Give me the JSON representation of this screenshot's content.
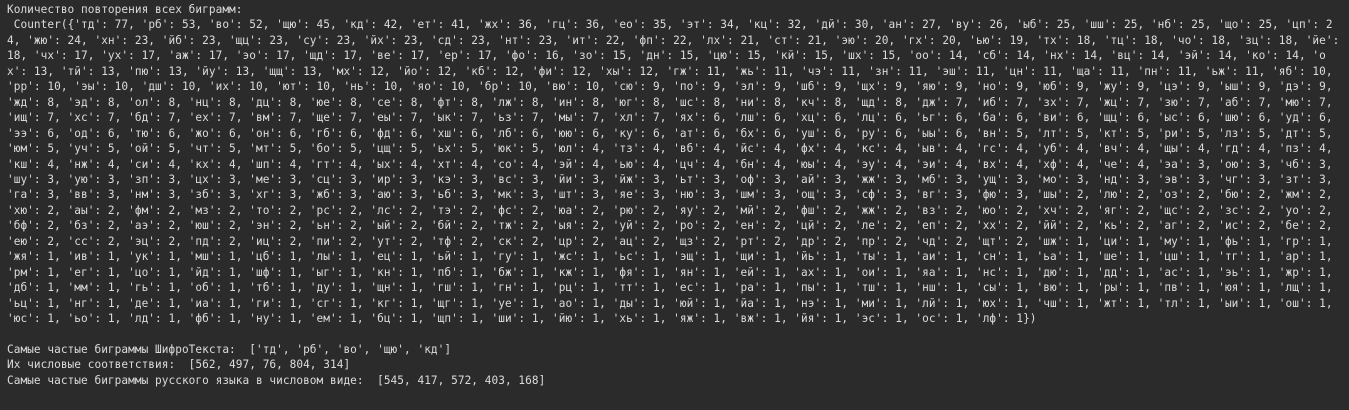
{
  "console": {
    "heading": "Количество повторения всех биграмм:",
    "counter_output": " Counter({'тд': 77, 'рб': 53, 'во': 52, 'щю': 45, 'кд': 42, 'ет': 41, 'жх': 36, 'гц': 36, 'ео': 35, 'эт': 34, 'кц': 32, 'дй': 30, 'ан': 27, 'ву': 26, 'ыб': 25, 'шш': 25, 'нб': 25, 'що': 25, 'цп': 24, 'жю': 24, 'хн': 23, 'йб': 23, 'щц': 23, 'су': 23, 'йх': 23, 'сд': 23, 'нт': 23, 'ит': 22, 'фп': 22, 'лх': 21, 'ст': 21, 'эю': 20, 'гх': 20, 'ью': 19, 'тх': 18, 'тц': 18, 'чо': 18, 'зц': 18, 'йе': 18, 'чх': 17, 'ух': 17, 'аж': 17, 'эо': 17, 'щд': 17, 'ве': 17, 'ер': 17, 'фо': 16, 'зо': 15, 'дн': 15, 'цю': 15, 'кй': 15, 'шх': 15, 'оо': 14, 'сб': 14, 'нх': 14, 'вц': 14, 'эй': 14, 'ко': 14, 'ох': 13, 'тй': 13, 'пю': 13, 'йу': 13, 'щщ': 13, 'мх': 12, 'йо': 12, 'кб': 12, 'фи': 12, 'хы': 12, 'гж': 11, 'жь': 11, 'чэ': 11, 'зн': 11, 'эш': 11, 'цн': 11, 'ща': 11, 'пн': 11, 'ьж': 11, 'яб': 10, 'рр': 10, 'эы': 10, 'дш': 10, 'их': 10, 'ют': 10, 'нь': 10, 'яо': 10, 'бр': 10, 'вю': 10, 'сю': 9, 'по': 9, 'эл': 9, 'шб': 9, 'щх': 9, 'яю': 9, 'но': 9, 'юб': 9, 'жу': 9, 'цэ': 9, 'ыш': 9, 'дэ': 9, 'жд': 8, 'эд': 8, 'ол': 8, 'нц': 8, 'дц': 8, 'юе': 8, 'се': 8, 'фт': 8, 'лж': 8, 'ин': 8, 'юг': 8, 'шс': 8, 'ни': 8, 'кч': 8, 'щд': 8, 'дж': 7, 'иб': 7, 'зх': 7, 'жц': 7, 'зю': 7, 'аб': 7, 'мю': 7, 'ищ': 7, 'хс': 7, 'бд': 7, 'ех': 7, 'вм': 7, 'ще': 7, 'еы': 7, 'ык': 7, 'ьз': 7, 'мы': 7, 'хл': 7, 'ях': 6, 'лш': 6, 'хц': 6, 'лц': 6, 'ьг': 6, 'ба': 6, 'ви': 6, 'щц': 6, 'ыс': 6, 'шю': 6, 'уд': 6, 'ээ': 6, 'од': 6, 'тю': 6, 'жо': 6, 'он': 6, 'гб': 6, 'фд': 6, 'хш': 6, 'лб': 6, 'юю': 6, 'ку': 6, 'ат': 6, 'бх': 6, 'уш': 6, 'ру': 6, 'ыы': 6, 'вн': 5, 'лт': 5, 'кт': 5, 'ри': 5, 'лз': 5, 'дт': 5, 'юм': 5, 'уч': 5, 'ой': 5, 'чт': 5, 'мт': 5, 'бо': 5, 'цщ': 5, 'ьх': 5, 'юк': 5, 'юл': 4, 'тз': 4, 'вб': 4, 'йс': 4, 'фх': 4, 'кс': 4, 'ыв': 4, 'гс': 4, 'уб': 4, 'вч': 4, 'щы': 4, 'гд': 4, 'пз': 4, 'кш': 4, 'нж': 4, 'си': 4, 'кх': 4, 'шп': 4, 'гт': 4, 'ых': 4, 'хт': 4, 'со': 4, 'эй': 4, 'ью': 4, 'цч': 4, 'бн': 4, 'юы': 4, 'эу': 4, 'эи': 4, 'вх': 4, 'хф': 4, 'че': 4, 'эа': 3, 'ою': 3, 'чб': 3, 'шу': 3, 'ую': 3, 'зп': 3, 'цх': 3, 'ме': 3, 'сц': 3, 'ир': 3, 'кэ': 3, 'вс': 3, 'йи': 3, 'йж': 3, 'ьт': 3, 'оф': 3, 'ай': 3, 'жж': 3, 'мб': 3, 'ущ': 3, 'мо': 3, 'нд': 3, 'эв': 3, 'чг': 3, 'зт': 3, 'га': 3, 'вв': 3, 'нм': 3, 'зб': 3, 'хг': 3, 'жб': 3, 'аю': 3, 'ьб': 3, 'мк': 3, 'шт': 3, 'яе': 3, 'ню': 3, 'шм': 3, 'ощ': 3, 'сф': 3, 'вг': 3, 'фю': 3, 'шы': 2, 'лю': 2, 'оз': 2, 'бю': 2, 'жм': 2, 'хю': 2, 'аы': 2, 'фм': 2, 'мз': 2, 'то': 2, 'рс': 2, 'лс': 2, 'тэ': 2, 'фс': 2, 'юа': 2, 'рю': 2, 'яу': 2, 'мй': 2, 'фш': 2, 'жж': 2, 'вз': 2, 'юо': 2, 'хч': 2, 'яг': 2, 'щс': 2, 'зс': 2, 'уо': 2, 'бф': 2, 'бз': 2, 'аэ': 2, 'юш': 2, 'эн': 2, 'ьн': 2, 'ый': 2, 'бй': 2, 'тж': 2, 'ыя': 2, 'уй': 2, 'ро': 2, 'ен': 2, 'цй': 2, 'ле': 2, 'еп': 2, 'хх': 2, 'йй': 2, 'кь': 2, 'аг': 2, 'ис': 2, 'бе': 2, 'ею': 2, 'сс': 2, 'эц': 2, 'пд': 2, 'иц': 2, 'пи': 2, 'ут': 2, 'тф': 2, 'ск': 2, 'цр': 2, 'ац': 2, 'щз': 2, 'рт': 2, 'др': 2, 'пр': 2, 'чд': 2, 'щт': 2, 'шж': 1, 'ци': 1, 'му': 1, 'фь': 1, 'гр': 1, 'жя': 1, 'ив': 1, 'ук': 1, 'мш': 1, 'цб': 1, 'лы': 1, 'ец': 1, 'ьй': 1, 'гу': 1, 'жс': 1, 'ьс': 1, 'эщ': 1, 'щи': 1, 'йь': 1, 'ты': 1, 'аи': 1, 'сн': 1, 'ьа': 1, 'ше': 1, 'цш': 1, 'тг': 1, 'ар': 1, 'рм': 1, 'ег': 1, 'цо': 1, 'йд': 1, 'шф': 1, 'ыг': 1, 'кн': 1, 'пб': 1, 'бж': 1, 'кж': 1, 'фя': 1, 'ян': 1, 'ей': 1, 'ах': 1, 'ои': 1, 'яа': 1, 'нс': 1, 'дю': 1, 'дд': 1, 'ас': 1, 'эь': 1, 'жр': 1, 'дб': 1, 'мм': 1, 'гь': 1, 'об': 1, 'тб': 1, 'ду': 1, 'щн': 1, 'гш': 1, 'гн': 1, 'рц': 1, 'тт': 1, 'ес': 1, 'ра': 1, 'пы': 1, 'тш': 1, 'нш': 1, 'сы': 1, 'вю': 1, 'ры': 1, 'пв': 1, 'юя': 1, 'лщ': 1, 'ьц': 1, 'нг': 1, 'де': 1, 'иа': 1, 'ги': 1, 'сг': 1, 'кг': 1, 'щг': 1, 'уе': 1, 'ао': 1, 'ды': 1, 'юй': 1, 'йа': 1, 'нэ': 1, 'ми': 1, 'лй': 1, 'юх': 1, 'чш': 1, 'жт': 1, 'тл': 1, 'ыи': 1, 'ош': 1, 'юс': 1, 'ьо': 1, 'лд': 1, 'фб': 1, 'ну': 1, 'ем': 1, 'бц': 1, 'щп': 1, 'ши': 1, 'йю': 1, 'хь': 1, 'яж': 1, 'вж': 1, 'йя': 1, 'эс': 1, 'ос': 1, 'лф': 1})",
    "result_line_1": "Самые частые биграммы ШифроТекста:  ['тд', 'рб', 'во', 'щю', 'кд']",
    "result_line_2": "Их числовые соответствия:  [562, 497, 76, 804, 314]",
    "result_line_3": "Самые частые биграммы русского языка в числовом виде:  [545, 417, 572, 403, 168]"
  },
  "colors": {
    "background": "#2b2b2b",
    "text": "#dcdcdc"
  }
}
